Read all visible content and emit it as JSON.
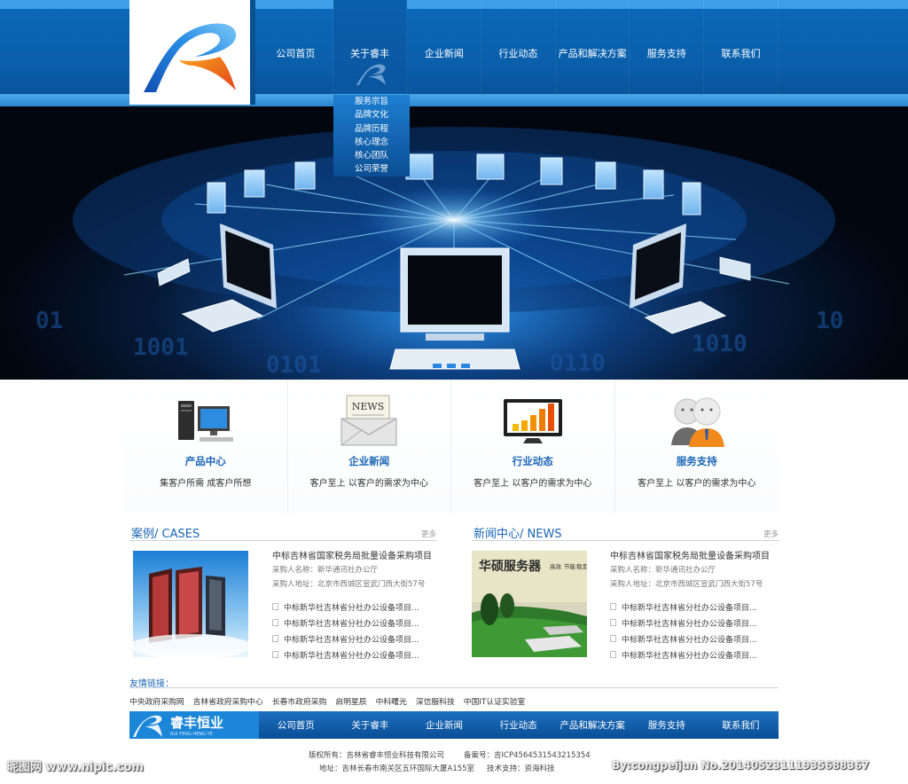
{
  "nav": {
    "items": [
      "公司首页",
      "关于睿丰",
      "企业新闻",
      "行业动态",
      "产品和解决方案",
      "服务支持",
      "联系我们"
    ],
    "submenu": [
      "服务宗旨",
      "品牌文化",
      "品牌历程",
      "核心理念",
      "核心团队",
      "公司荣誉"
    ]
  },
  "features": [
    {
      "title": "产品中心",
      "subtitle": "集客户所需  成客户所想",
      "icon": "computer-icon"
    },
    {
      "title": "企业新闻",
      "subtitle": "客户至上   以客户的需求为中心",
      "icon": "news-envelope-icon"
    },
    {
      "title": "行业动态",
      "subtitle": "客户至上   以客户的需求为中心",
      "icon": "chart-monitor-icon"
    },
    {
      "title": "服务支持",
      "subtitle": "客户至上   以客户的需求为中心",
      "icon": "support-people-icon"
    }
  ],
  "cases": {
    "title": "案例/  CASES",
    "more": "更多",
    "headline": "中标吉林省国家税务局批量设备采购项目",
    "buyer": "采购人名称：新华通讯社办公厅",
    "address": "采购人地址：北京市西城区宣武门西大街57号",
    "items": [
      "中标新华社吉林省分社办公设备项目...",
      "中标新华社吉林省分社办公设备项目...",
      "中标新华社吉林省分社办公设备项目...",
      "中标新华社吉林省分社办公设备项目..."
    ]
  },
  "news": {
    "title": "新闻中心/ NEWS",
    "more": "更多",
    "image_text": "华硕服务器",
    "image_tags": [
      "高效",
      "节能",
      "稳定"
    ],
    "headline": "中标吉林省国家税务局批量设备采购项目",
    "buyer": "采购人名称：新华通讯社办公厅",
    "address": "采购人地址：北京市西城区宣武门西大街57号",
    "items": [
      "中标新华社吉林省分社办公设备项目...",
      "中标新华社吉林省分社办公设备项目...",
      "中标新华社吉林省分社办公设备项目...",
      "中标新华社吉林省分社办公设备项目..."
    ]
  },
  "links": {
    "title": "友情链接：",
    "items": [
      "中央政府采购网",
      "吉林省政府采购中心",
      "长春市政府采购",
      "启明星辰",
      "中科曙光",
      "深信服科技",
      "中国IT认证实验室"
    ]
  },
  "footer_nav": {
    "logo_text": "睿丰恒业",
    "logo_sub": "RUI FENG HENG YE",
    "items": [
      "公司首页",
      "关于睿丰",
      "企业新闻",
      "行业动态",
      "产品和解决方案",
      "服务支持",
      "联系我们"
    ]
  },
  "copyright": {
    "line1_left": "版权所有：吉林省睿丰恒业科技有限公司",
    "line1_right": "备案号：吉ICP4564531543215354",
    "line2_left": "地址：吉林长春市南关区五环国际大厦A155室",
    "line2_right": "技术支持：资海科技"
  },
  "watermark": {
    "left": "昵图网 www.nipic.com",
    "right": "By:congpeijun  No.20140523111935688367"
  },
  "colors": {
    "brand_blue": "#0a5fab",
    "accent_blue": "#1a66b5",
    "logo_orange": "#f07a1e"
  }
}
